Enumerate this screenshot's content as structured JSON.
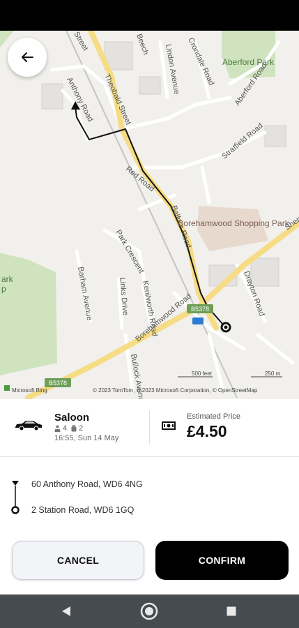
{
  "map": {
    "street_labels": [
      "Street",
      "Beech",
      "Anthony Road",
      "Theobald Street",
      "Red Road",
      "Lindon Avenue",
      "Crondale Road",
      "Aberford Road",
      "Stratfield Road",
      "Park Crescent",
      "Barham Avenue",
      "Links Drive",
      "Kenilworth Road",
      "Borehamwood Road",
      "Drayton Road",
      "Bullock Avenue",
      "Balfour Road",
      "Shenley Road",
      "B5378"
    ],
    "place_labels": [
      "Aberford Park",
      "Borehamwood Shopping Park",
      "ark",
      "p"
    ],
    "road_shields": [
      "B5378",
      "B5378"
    ],
    "scale": {
      "feet": "500 feet",
      "metres": "250 m"
    },
    "attribution": "© 2023 TomTom, © 2023 Microsoft Corporation, © OpenStreetMap",
    "brand": "Microsoft Bing"
  },
  "back_button": {
    "icon": "arrow-left-icon"
  },
  "vehicle": {
    "name": "Saloon",
    "passengers": "4",
    "luggage": "2",
    "datetime": "16:55, Sun 14 May",
    "icon": "car-icon"
  },
  "price": {
    "label": "Estimated Price",
    "value": "£4.50",
    "icon": "cash-icon"
  },
  "route": {
    "pickup": "60 Anthony Road, WD6 4NG",
    "dropoff": "2 Station Road, WD6 1GQ"
  },
  "actions": {
    "cancel_label": "CANCEL",
    "confirm_label": "CONFIRM"
  },
  "colors": {
    "primary": "#000000",
    "secondary_bg": "#f3f4f7",
    "major_road": "#f6dc84",
    "park": "#cfe3bf",
    "nav_bar": "#454b4e"
  }
}
